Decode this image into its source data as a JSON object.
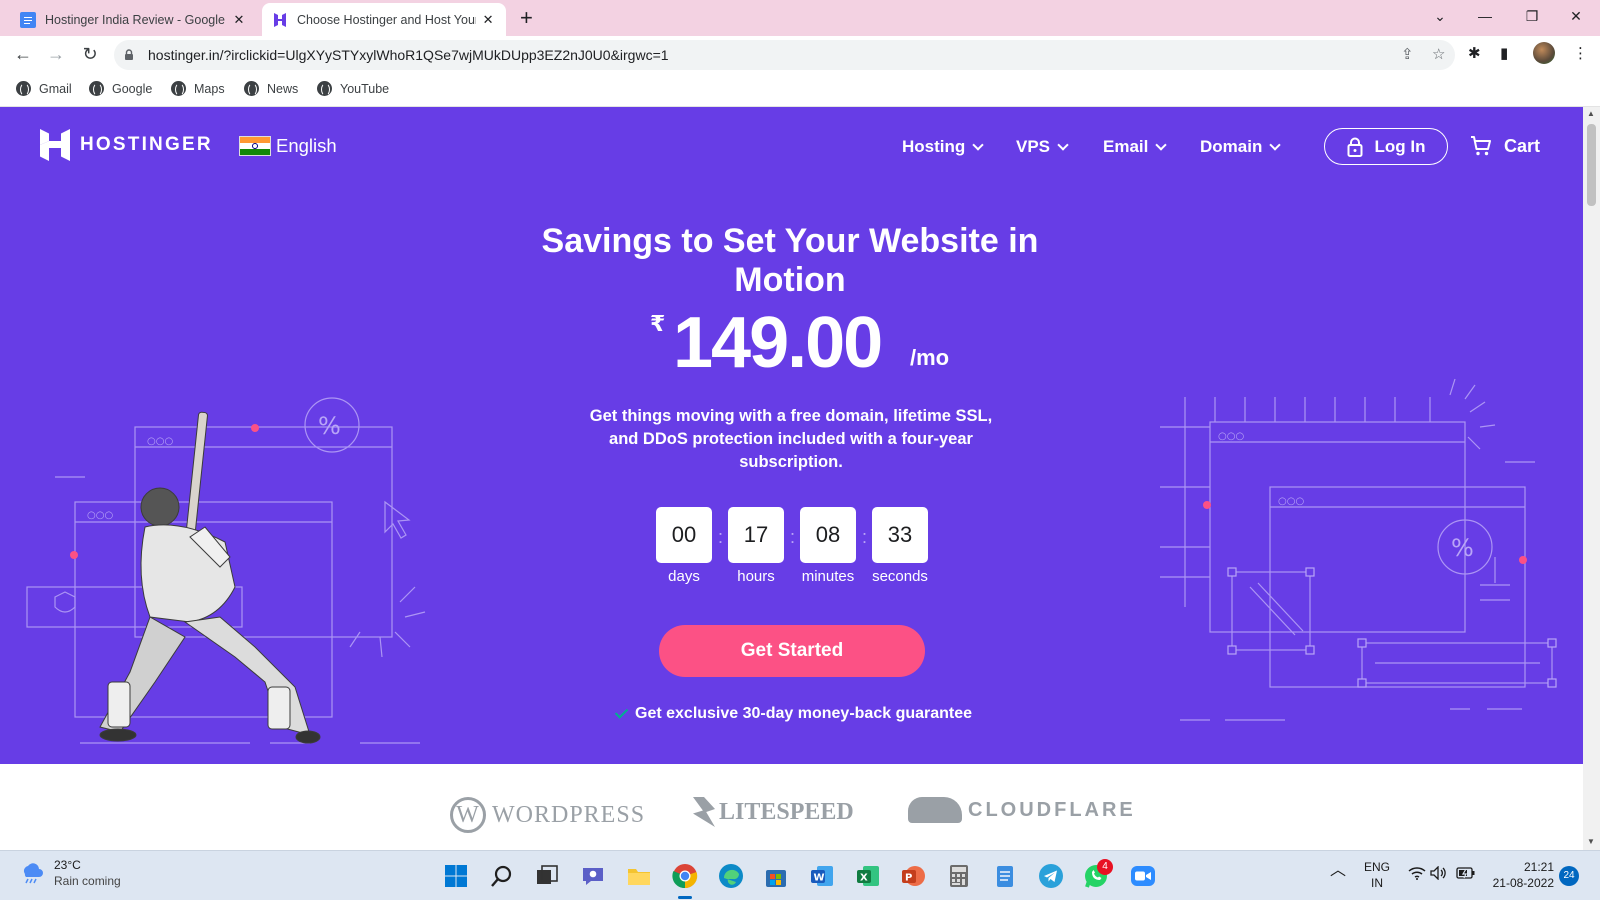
{
  "browser": {
    "tabs": [
      {
        "title": "Hostinger India Review - Google",
        "active": false
      },
      {
        "title": "Choose Hostinger and Host Your",
        "active": true
      }
    ],
    "url": "hostinger.in/?irclickid=UlgXYySTYxylWhoR1QSe7wjMUkDUpp3EZ2nJ0U0&irgwc=1",
    "bookmarks": [
      "Gmail",
      "Google",
      "Maps",
      "News",
      "YouTube"
    ]
  },
  "site": {
    "brand": "HOSTINGER",
    "language": "English",
    "nav": [
      "Hosting",
      "VPS",
      "Email",
      "Domain"
    ],
    "login_label": "Log In",
    "cart_label": "Cart",
    "colors": {
      "hero_bg": "#673de6",
      "cta": "#fc5185",
      "check": "#00b090"
    }
  },
  "hero": {
    "headline": "Savings to Set Your Website in Motion",
    "currency": "₹",
    "price": "149.00",
    "period": "/mo",
    "description": "Get things moving with a free domain, lifetime SSL, and DDoS protection included with a four-year subscription.",
    "countdown": [
      {
        "value": "00",
        "label": "days"
      },
      {
        "value": "17",
        "label": "hours"
      },
      {
        "value": "08",
        "label": "minutes"
      },
      {
        "value": "33",
        "label": "seconds"
      }
    ],
    "cta_label": "Get Started",
    "guarantee": "Get exclusive 30-day money-back guarantee"
  },
  "partners": [
    "WordPress",
    "LITESPEED",
    "CLOUDFLARE"
  ],
  "taskbar": {
    "weather_temp": "23°C",
    "weather_text": "Rain coming",
    "lang_top": "ENG",
    "lang_bottom": "IN",
    "time": "21:21",
    "date": "21-08-2022",
    "notifications": "24",
    "whatsapp_badge": "4"
  }
}
